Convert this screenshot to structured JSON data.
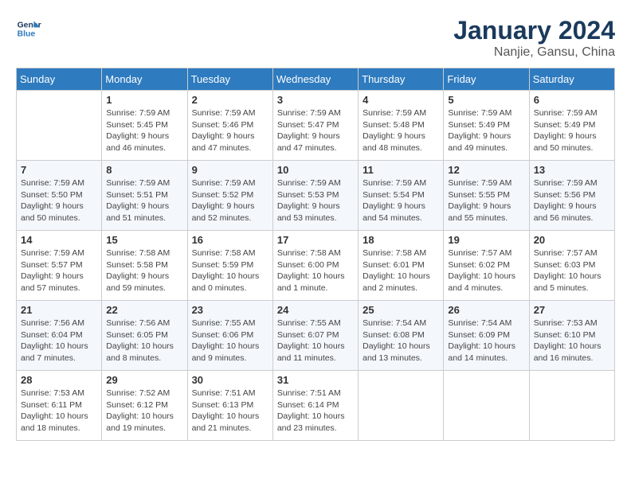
{
  "header": {
    "logo_line1": "General",
    "logo_line2": "Blue",
    "title": "January 2024",
    "subtitle": "Nanjie, Gansu, China"
  },
  "calendar": {
    "days_of_week": [
      "Sunday",
      "Monday",
      "Tuesday",
      "Wednesday",
      "Thursday",
      "Friday",
      "Saturday"
    ],
    "weeks": [
      [
        {
          "day": "",
          "info": ""
        },
        {
          "day": "1",
          "info": "Sunrise: 7:59 AM\nSunset: 5:45 PM\nDaylight: 9 hours\nand 46 minutes."
        },
        {
          "day": "2",
          "info": "Sunrise: 7:59 AM\nSunset: 5:46 PM\nDaylight: 9 hours\nand 47 minutes."
        },
        {
          "day": "3",
          "info": "Sunrise: 7:59 AM\nSunset: 5:47 PM\nDaylight: 9 hours\nand 47 minutes."
        },
        {
          "day": "4",
          "info": "Sunrise: 7:59 AM\nSunset: 5:48 PM\nDaylight: 9 hours\nand 48 minutes."
        },
        {
          "day": "5",
          "info": "Sunrise: 7:59 AM\nSunset: 5:49 PM\nDaylight: 9 hours\nand 49 minutes."
        },
        {
          "day": "6",
          "info": "Sunrise: 7:59 AM\nSunset: 5:49 PM\nDaylight: 9 hours\nand 50 minutes."
        }
      ],
      [
        {
          "day": "7",
          "info": "Sunrise: 7:59 AM\nSunset: 5:50 PM\nDaylight: 9 hours\nand 50 minutes."
        },
        {
          "day": "8",
          "info": "Sunrise: 7:59 AM\nSunset: 5:51 PM\nDaylight: 9 hours\nand 51 minutes."
        },
        {
          "day": "9",
          "info": "Sunrise: 7:59 AM\nSunset: 5:52 PM\nDaylight: 9 hours\nand 52 minutes."
        },
        {
          "day": "10",
          "info": "Sunrise: 7:59 AM\nSunset: 5:53 PM\nDaylight: 9 hours\nand 53 minutes."
        },
        {
          "day": "11",
          "info": "Sunrise: 7:59 AM\nSunset: 5:54 PM\nDaylight: 9 hours\nand 54 minutes."
        },
        {
          "day": "12",
          "info": "Sunrise: 7:59 AM\nSunset: 5:55 PM\nDaylight: 9 hours\nand 55 minutes."
        },
        {
          "day": "13",
          "info": "Sunrise: 7:59 AM\nSunset: 5:56 PM\nDaylight: 9 hours\nand 56 minutes."
        }
      ],
      [
        {
          "day": "14",
          "info": "Sunrise: 7:59 AM\nSunset: 5:57 PM\nDaylight: 9 hours\nand 57 minutes."
        },
        {
          "day": "15",
          "info": "Sunrise: 7:58 AM\nSunset: 5:58 PM\nDaylight: 9 hours\nand 59 minutes."
        },
        {
          "day": "16",
          "info": "Sunrise: 7:58 AM\nSunset: 5:59 PM\nDaylight: 10 hours\nand 0 minutes."
        },
        {
          "day": "17",
          "info": "Sunrise: 7:58 AM\nSunset: 6:00 PM\nDaylight: 10 hours\nand 1 minute."
        },
        {
          "day": "18",
          "info": "Sunrise: 7:58 AM\nSunset: 6:01 PM\nDaylight: 10 hours\nand 2 minutes."
        },
        {
          "day": "19",
          "info": "Sunrise: 7:57 AM\nSunset: 6:02 PM\nDaylight: 10 hours\nand 4 minutes."
        },
        {
          "day": "20",
          "info": "Sunrise: 7:57 AM\nSunset: 6:03 PM\nDaylight: 10 hours\nand 5 minutes."
        }
      ],
      [
        {
          "day": "21",
          "info": "Sunrise: 7:56 AM\nSunset: 6:04 PM\nDaylight: 10 hours\nand 7 minutes."
        },
        {
          "day": "22",
          "info": "Sunrise: 7:56 AM\nSunset: 6:05 PM\nDaylight: 10 hours\nand 8 minutes."
        },
        {
          "day": "23",
          "info": "Sunrise: 7:55 AM\nSunset: 6:06 PM\nDaylight: 10 hours\nand 9 minutes."
        },
        {
          "day": "24",
          "info": "Sunrise: 7:55 AM\nSunset: 6:07 PM\nDaylight: 10 hours\nand 11 minutes."
        },
        {
          "day": "25",
          "info": "Sunrise: 7:54 AM\nSunset: 6:08 PM\nDaylight: 10 hours\nand 13 minutes."
        },
        {
          "day": "26",
          "info": "Sunrise: 7:54 AM\nSunset: 6:09 PM\nDaylight: 10 hours\nand 14 minutes."
        },
        {
          "day": "27",
          "info": "Sunrise: 7:53 AM\nSunset: 6:10 PM\nDaylight: 10 hours\nand 16 minutes."
        }
      ],
      [
        {
          "day": "28",
          "info": "Sunrise: 7:53 AM\nSunset: 6:11 PM\nDaylight: 10 hours\nand 18 minutes."
        },
        {
          "day": "29",
          "info": "Sunrise: 7:52 AM\nSunset: 6:12 PM\nDaylight: 10 hours\nand 19 minutes."
        },
        {
          "day": "30",
          "info": "Sunrise: 7:51 AM\nSunset: 6:13 PM\nDaylight: 10 hours\nand 21 minutes."
        },
        {
          "day": "31",
          "info": "Sunrise: 7:51 AM\nSunset: 6:14 PM\nDaylight: 10 hours\nand 23 minutes."
        },
        {
          "day": "",
          "info": ""
        },
        {
          "day": "",
          "info": ""
        },
        {
          "day": "",
          "info": ""
        }
      ]
    ]
  }
}
